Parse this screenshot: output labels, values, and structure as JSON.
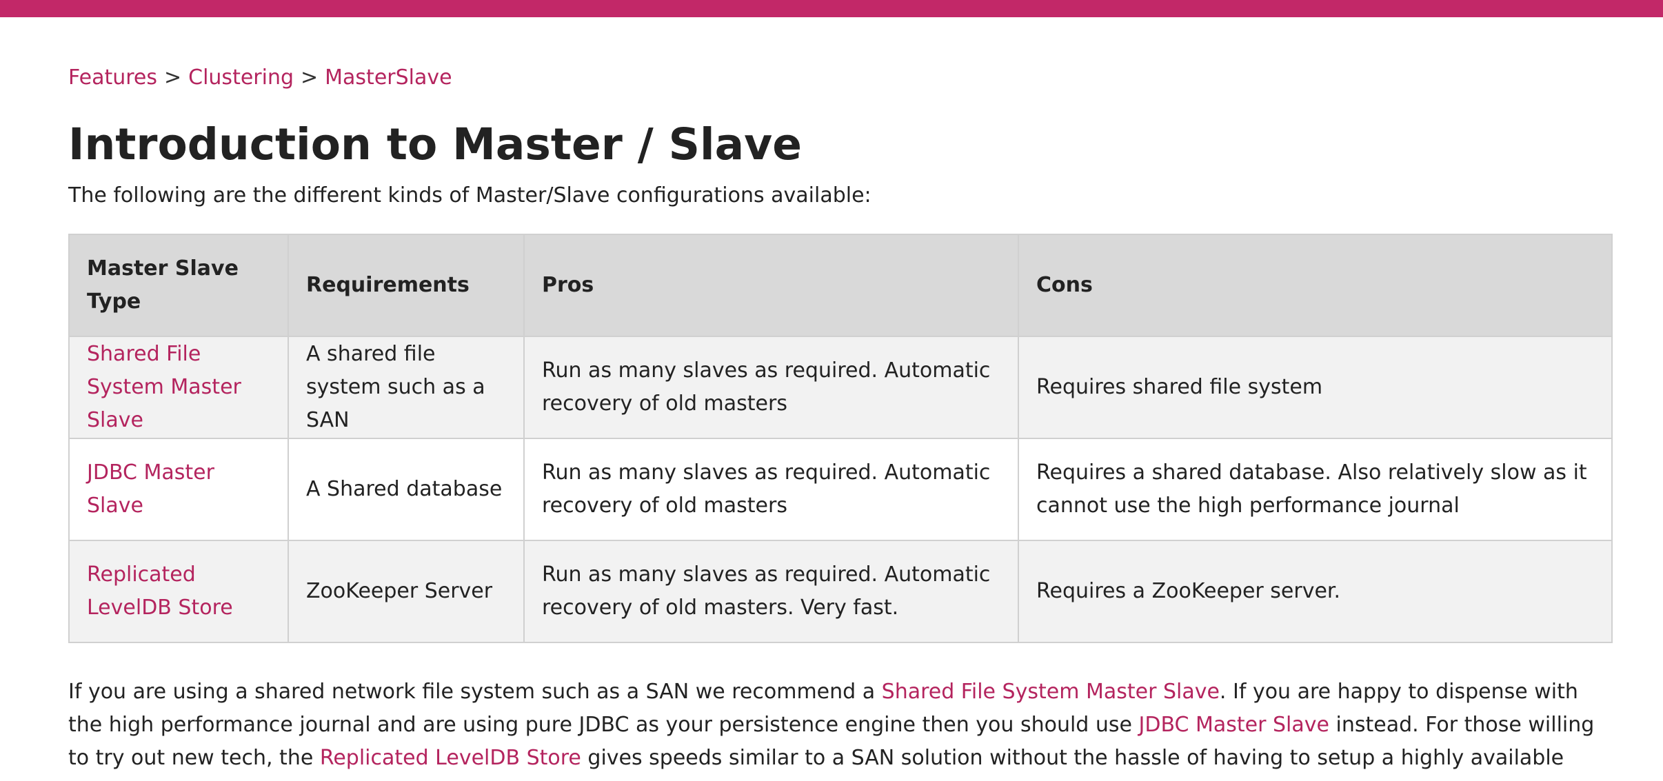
{
  "breadcrumb": {
    "items": [
      "Features",
      "Clustering",
      "MasterSlave"
    ],
    "separator": ">"
  },
  "page_title": "Introduction to Master / Slave",
  "intro_text": "The following are the different kinds of Master/Slave configurations available:",
  "table": {
    "headers": [
      "Master Slave Type",
      "Requirements",
      "Pros",
      "Cons"
    ],
    "rows": [
      {
        "type": "Shared File System Master Slave",
        "requirements": "A shared file system such as a SAN",
        "pros": "Run as many slaves as required. Automatic recovery of old masters",
        "cons": "Requires shared file system"
      },
      {
        "type": "JDBC Master Slave",
        "requirements": "A Shared database",
        "pros": "Run as many slaves as required. Automatic recovery of old masters",
        "cons": "Requires a shared database. Also relatively slow as it cannot use the high performance journal"
      },
      {
        "type": "Replicated LevelDB Store",
        "requirements": "ZooKeeper Server",
        "pros": "Run as many slaves as required. Automatic recovery of old masters. Very fast.",
        "cons": "Requires a ZooKeeper server."
      }
    ]
  },
  "outro": {
    "part1": "If you are using a shared network file system such as a SAN we recommend a ",
    "link1": "Shared File System Master Slave",
    "part2": ". If you are happy to dispense with the high performance journal and are using pure JDBC as your persistence engine then you should use ",
    "link2": "JDBC Master Slave",
    "part3": " instead. For those willing to try out new tech, the ",
    "link3": "Replicated LevelDB Store",
    "part4": " gives speeds similar to a SAN solution without the hassle of having to setup a highly available shared file system."
  },
  "colors": {
    "brand": "#c22868",
    "link": "#b4245e",
    "header_bg": "#d9d9d9",
    "row_alt_bg": "#f2f2f2"
  }
}
